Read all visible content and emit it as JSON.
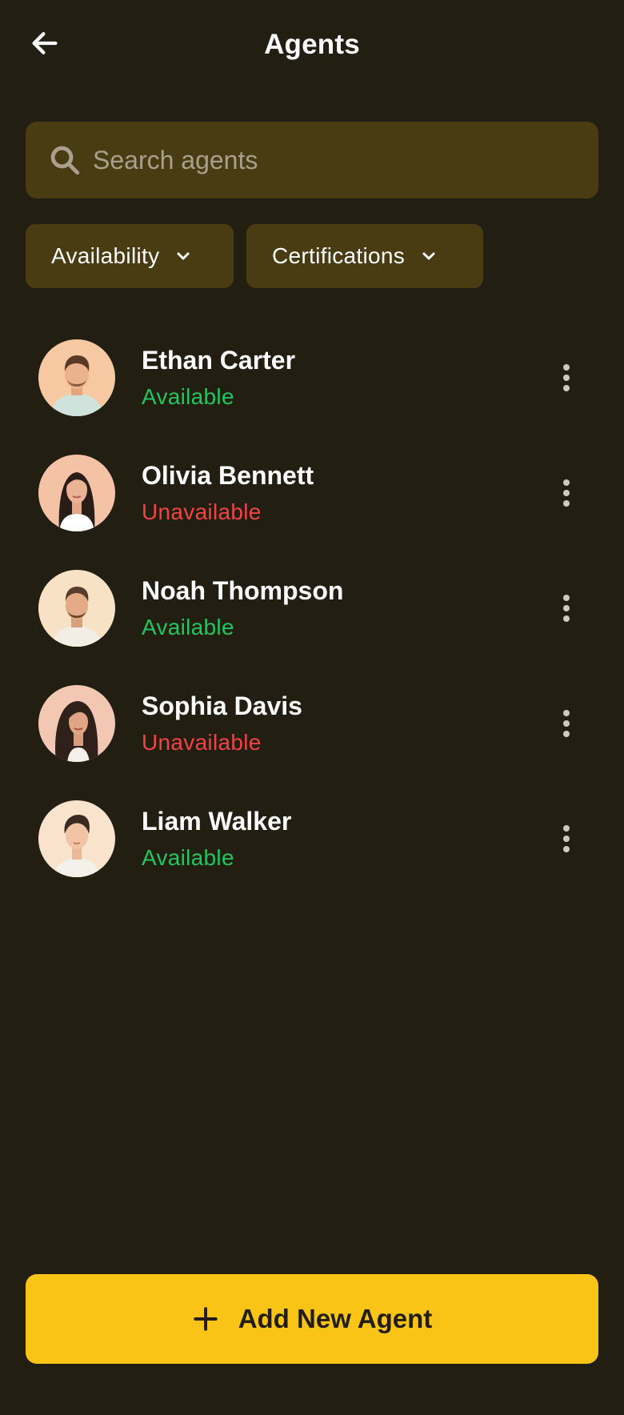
{
  "header": {
    "title": "Agents",
    "back_icon": "arrow-left-icon"
  },
  "search": {
    "placeholder": "Search agents",
    "value": "",
    "icon": "search-icon"
  },
  "filters": [
    {
      "label": "Availability",
      "icon": "chevron-down-icon"
    },
    {
      "label": "Certifications",
      "icon": "chevron-down-icon"
    }
  ],
  "agents": [
    {
      "name": "Ethan Carter",
      "status": "Available",
      "status_type": "available"
    },
    {
      "name": "Olivia Bennett",
      "status": "Unavailable",
      "status_type": "unavailable"
    },
    {
      "name": "Noah Thompson",
      "status": "Available",
      "status_type": "available"
    },
    {
      "name": "Sophia Davis",
      "status": "Unavailable",
      "status_type": "unavailable"
    },
    {
      "name": "Liam Walker",
      "status": "Available",
      "status_type": "available"
    }
  ],
  "add_button": {
    "label": "Add New Agent",
    "icon": "plus-icon"
  },
  "colors": {
    "background": "#231e12",
    "surface": "#4a3c12",
    "accent": "#f9c416",
    "available": "#22c55e",
    "unavailable": "#ef4444"
  }
}
